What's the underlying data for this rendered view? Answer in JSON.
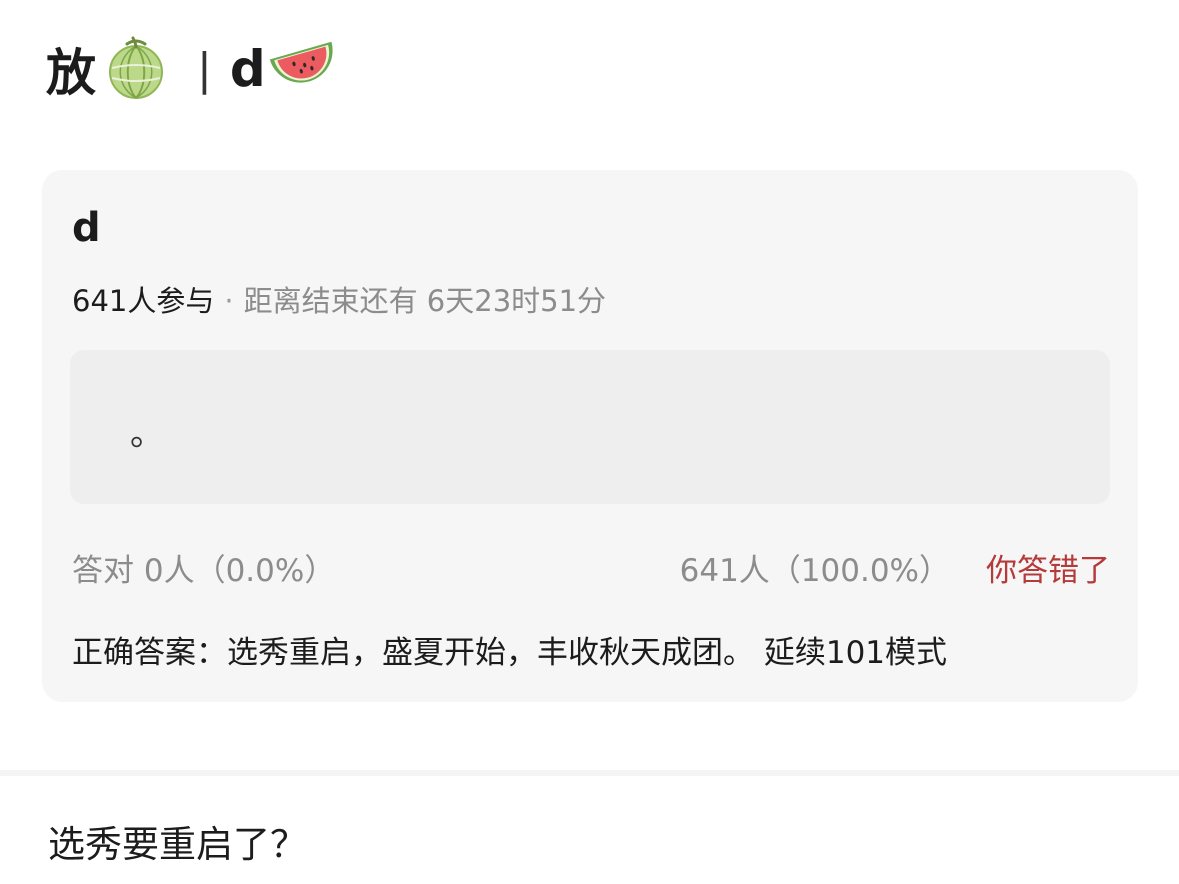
{
  "header": {
    "title_prefix": "放",
    "title_icon": "melon-icon",
    "separator": "|",
    "title_suffix": "d",
    "title_icon_2": "watermelon-icon"
  },
  "quiz": {
    "title": "d",
    "participants": "641人参与",
    "dot": "·",
    "remaining": "距离结束还有 6天23时51分",
    "option_text": "。",
    "correct_stat": "答对  0人（0.0%）",
    "wrong_stat": "641人（100.0%）",
    "wrong_label": "你答错了",
    "correct_answer": "正确答案：选秀重启，盛夏开始，丰收秋天成团。 延续101模式"
  },
  "post": {
    "text": "选秀要重启了？"
  },
  "colors": {
    "card_bg": "#f6f6f6",
    "answer_box_bg": "#eeeeee",
    "wrong_red": "#b53a3a",
    "muted": "#8c8c8c"
  }
}
